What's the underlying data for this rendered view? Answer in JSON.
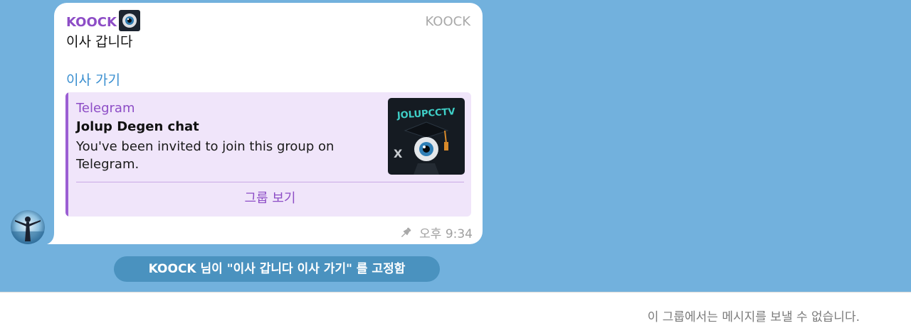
{
  "message": {
    "sender": "KOOCK",
    "channel_tag": "KOOCK",
    "text": "이사 갑니다",
    "link": "이사 가기",
    "time": "오후 9:34"
  },
  "link_preview": {
    "site": "Telegram",
    "title": "Jolup Degen chat",
    "description": "You've been invited to join this group on Telegram.",
    "button": "그룹 보기",
    "thumbnail_text": "JOLUPCCTV",
    "thumbnail_letter": "X"
  },
  "service_message": "KOOCK 님이 \"이사 갑니다  이사 가기\" 를 고정함",
  "footer": {
    "notice": "이 그룹에서는 메시지를 보낼 수 없습니다."
  },
  "colors": {
    "chat_background": "#72b1dd",
    "accent_purple": "#8d4dc6",
    "link_blue": "#3a8fd0",
    "preview_background": "#f0e5fa",
    "service_pill": "#4a92bf"
  },
  "icons": {
    "pin": "pin-icon",
    "avatar": "user-avatar",
    "sender_badge": "eye-badge-icon"
  }
}
